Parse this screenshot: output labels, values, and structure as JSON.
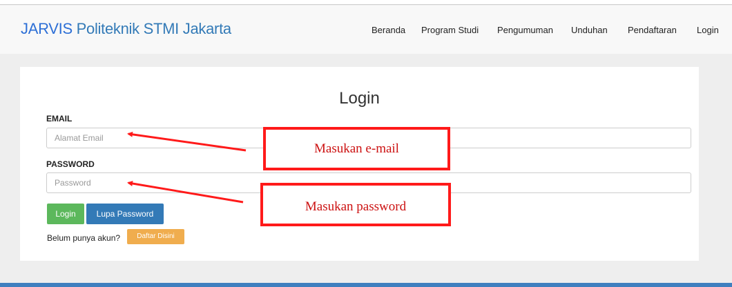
{
  "brand": {
    "accent": "JARVIS",
    "name": "Politeknik STMI Jakarta"
  },
  "nav": {
    "items": [
      {
        "label": "Beranda"
      },
      {
        "label": "Program Studi"
      },
      {
        "label": "Pengumuman"
      },
      {
        "label": "Unduhan"
      },
      {
        "label": "Pendaftaran"
      },
      {
        "label": "Login"
      }
    ]
  },
  "form": {
    "title": "Login",
    "email_label": "EMAIL",
    "email_placeholder": "Alamat Email",
    "password_label": "PASSWORD",
    "password_placeholder": "Password",
    "login_button": "Login",
    "forgot_button": "Lupa Password",
    "signup_text": "Belum punya akun?",
    "signup_button": "Daftar Disini"
  },
  "annotations": {
    "email_callout": "Masukan e-mail",
    "password_callout": "Masukan password"
  },
  "colors": {
    "brand": "#337ab7",
    "login_button": "#5cb85c",
    "forgot_button": "#337ab7",
    "signup_button": "#f0ad4e",
    "annotation": "#ff1a1a"
  }
}
